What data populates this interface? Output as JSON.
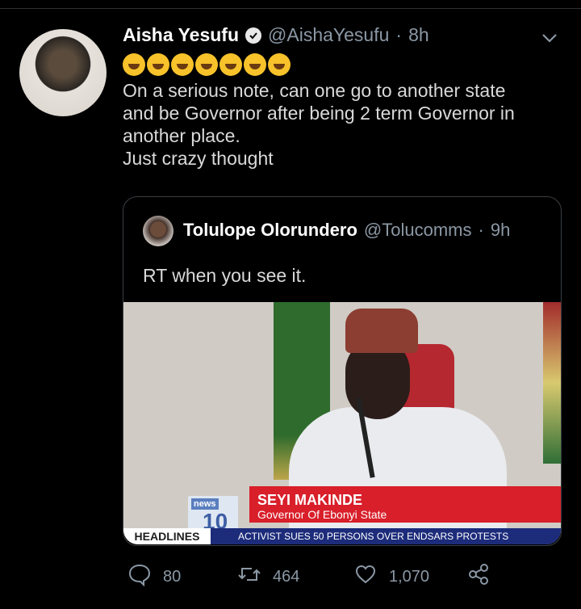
{
  "tweet": {
    "author_name": "Aisha Yesufu",
    "handle": "@AishaYesufu",
    "separator": "·",
    "time": "8h",
    "emoji_count": 7,
    "emoji_name": "rolling-on-the-floor-laughing",
    "lines": [
      "On a serious note, can one go to another state",
      "and be Governor after being 2 term Governor in",
      "another place.",
      "Just crazy thought"
    ]
  },
  "quoted": {
    "author_name": "Tolulope Olorundero",
    "handle": "@Tolucomms",
    "separator": "·",
    "time": "9h",
    "text": "RT when you see it.",
    "media": {
      "logo_top": "news",
      "logo_main": "10",
      "lower_third_name": "SEYI MAKINDE",
      "lower_third_role": "Governor Of Ebonyi State",
      "headlines_label": "HEADLINES",
      "ticker_text": "ACTIVIST SUES 50 PERSONS OVER ENDSARS PROTESTS"
    }
  },
  "actions": {
    "reply_count": "80",
    "retweet_count": "464",
    "like_count": "1,070"
  },
  "colors": {
    "background": "#000000",
    "secondary_text": "#8b98a5",
    "primary_text": "#d9d9d9",
    "news_red": "#d81f2a",
    "ticker_blue": "#1c2b7a"
  }
}
